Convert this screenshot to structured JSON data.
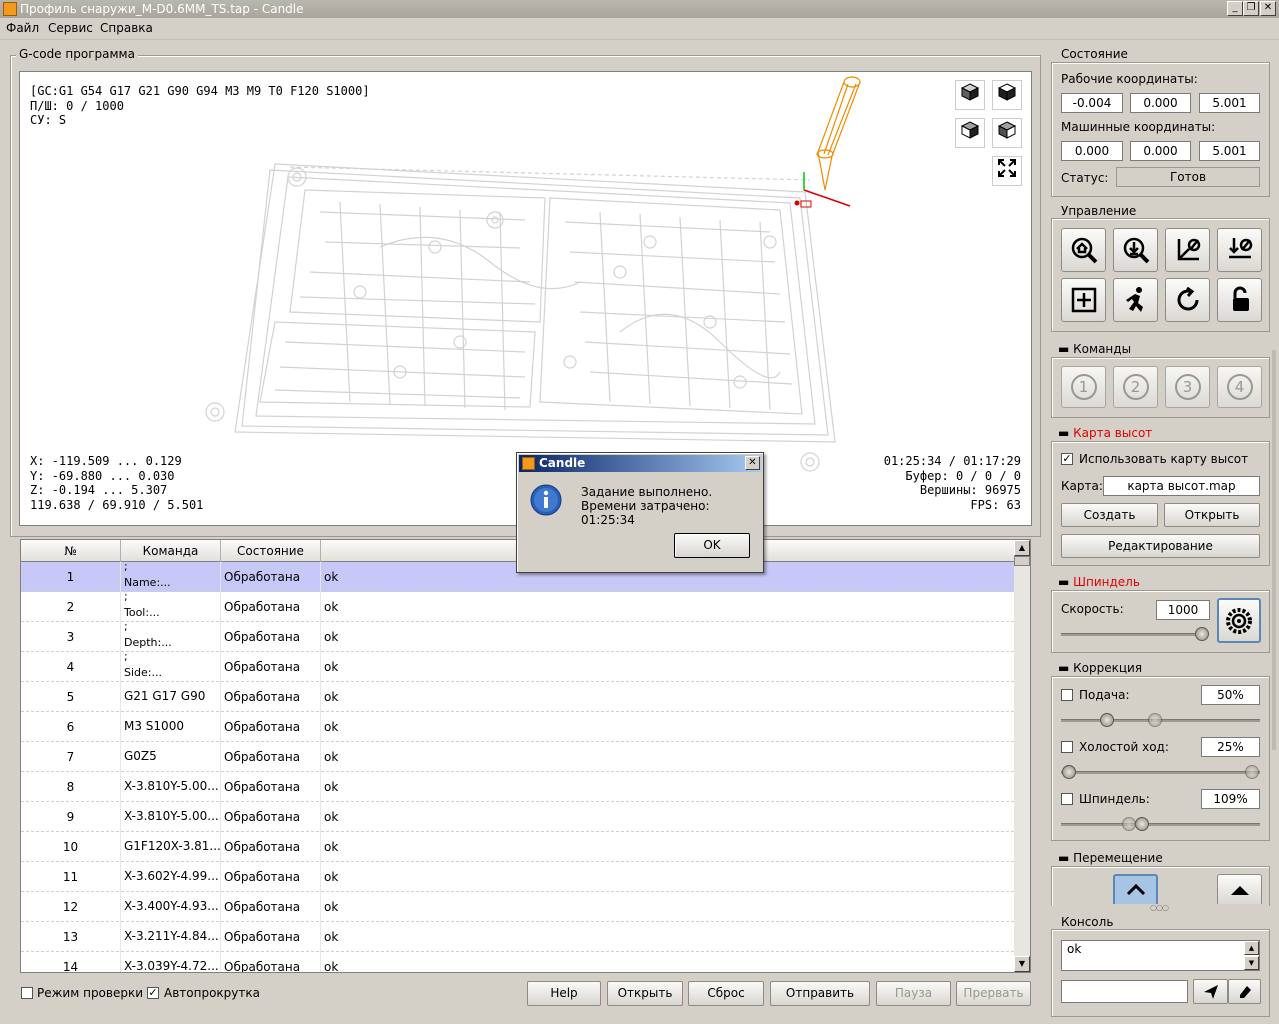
{
  "window": {
    "title": "Профиль снаружи_M-D0.6MM_TS.tap - Candle",
    "buttons": {
      "minimize": "_",
      "restore": "❐",
      "close": "✕"
    }
  },
  "menu": [
    "Файл",
    "Сервис",
    "Справка"
  ],
  "gcode_group": {
    "title": "G-code программа",
    "info_top": "[GC:G1 G54 G17 G21 G90 G94 M3 M9 T0 F120 S1000]\nП/Ш: 0 / 1000\nСУ: S",
    "info_bottom_left": "X: -119.509 ... 0.129\nY: -69.880 ... 0.030\nZ: -0.194 ... 5.307\n119.638 / 69.910 / 5.501",
    "info_bottom_right": "01:25:34 / 01:17:29\nБуфер: 0 / 0 / 0\nВершины: 96975\nFPS: 63"
  },
  "table": {
    "headers": [
      "№",
      "Команда",
      "Состояние"
    ],
    "rows": [
      {
        "num": "1",
        "cmd1": ";",
        "cmd2": "Name:...",
        "state": "Обработана",
        "resp": "ok"
      },
      {
        "num": "2",
        "cmd1": ";",
        "cmd2": "Tool:...",
        "state": "Обработана",
        "resp": "ok"
      },
      {
        "num": "3",
        "cmd1": ";",
        "cmd2": "Depth:...",
        "state": "Обработана",
        "resp": "ok"
      },
      {
        "num": "4",
        "cmd1": ";",
        "cmd2": "Side:...",
        "state": "Обработана",
        "resp": "ok"
      },
      {
        "num": "5",
        "cmd1": "",
        "cmd2": "G21 G17 G90",
        "state": "Обработана",
        "resp": "ok"
      },
      {
        "num": "6",
        "cmd1": "",
        "cmd2": "M3 S1000",
        "state": "Обработана",
        "resp": "ok"
      },
      {
        "num": "7",
        "cmd1": "",
        "cmd2": "G0Z5",
        "state": "Обработана",
        "resp": "ok"
      },
      {
        "num": "8",
        "cmd1": "",
        "cmd2": "X-3.810Y-5.00...",
        "state": "Обработана",
        "resp": "ok"
      },
      {
        "num": "9",
        "cmd1": "",
        "cmd2": "X-3.810Y-5.00...",
        "state": "Обработана",
        "resp": "ok"
      },
      {
        "num": "10",
        "cmd1": "",
        "cmd2": "G1F120X-3.81...",
        "state": "Обработана",
        "resp": "ok"
      },
      {
        "num": "11",
        "cmd1": "",
        "cmd2": "X-3.602Y-4.99...",
        "state": "Обработана",
        "resp": "ok"
      },
      {
        "num": "12",
        "cmd1": "",
        "cmd2": "X-3.400Y-4.93...",
        "state": "Обработана",
        "resp": "ok"
      },
      {
        "num": "13",
        "cmd1": "",
        "cmd2": "X-3.211Y-4.84...",
        "state": "Обработана",
        "resp": "ok"
      },
      {
        "num": "14",
        "cmd1": "",
        "cmd2": "X-3.039Y-4.72...",
        "state": "Обработана",
        "resp": "ok"
      }
    ]
  },
  "bottom": {
    "check_mode": "Режим проверки",
    "autoscroll": "Автопрокрутка",
    "autoscroll_checked": true,
    "buttons": [
      "Help",
      "Открыть",
      "Сброс",
      "Отправить",
      "Пауза",
      "Прервать"
    ]
  },
  "state_group": {
    "title": "Состояние",
    "work_label": "Рабочие координаты:",
    "work": [
      "-0.004",
      "0.000",
      "5.001"
    ],
    "machine_label": "Машинные координаты:",
    "machine": [
      "0.000",
      "0.000",
      "5.001"
    ],
    "status_label": "Статус:",
    "status": "Готов"
  },
  "control_group": {
    "title": "Управление"
  },
  "commands_group": {
    "title": "Команды",
    "buttons": [
      "1",
      "2",
      "3",
      "4"
    ]
  },
  "heightmap_group": {
    "title": "Карта высот",
    "use_label": "Использовать карту высот",
    "map_label": "Карта:",
    "map_value": "карта высот.map",
    "create": "Создать",
    "open": "Открыть",
    "edit": "Редактирование"
  },
  "spindle_group": {
    "title": "Шпиндель",
    "speed_label": "Скорость:",
    "speed": "1000"
  },
  "correction_group": {
    "title": "Коррекция",
    "feed_label": "Подача:",
    "feed": "50%",
    "rapid_label": "Холостой ход:",
    "rapid": "25%",
    "spindle_label": "Шпиндель:",
    "spindle": "109%"
  },
  "jog_group": {
    "title": "Перемещение"
  },
  "console_group": {
    "title": "Консоль",
    "output": "ok"
  },
  "dialog": {
    "title": "Candle",
    "line1": "Задание выполнено.",
    "line2": "Времени затрачено: 01:25:34",
    "ok": "OK"
  },
  "colors": {
    "accent_red": "#e00000",
    "selected_row": "#c8c8f8",
    "tool": "#f08c00"
  }
}
